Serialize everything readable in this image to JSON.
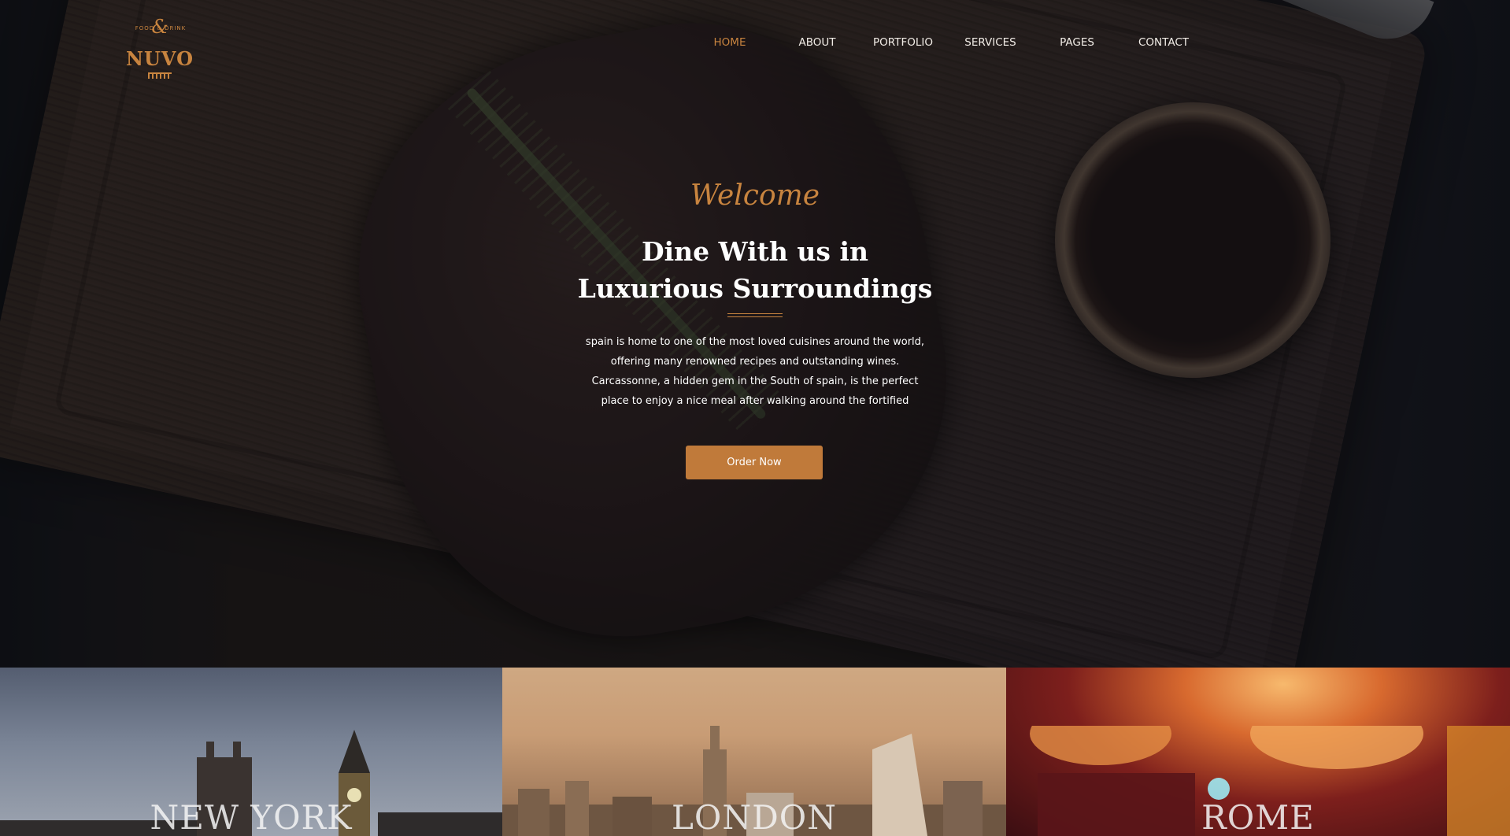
{
  "brand": {
    "logo_top": "FOOD & DRINK",
    "logo_amp": "&",
    "logo_name": "NUVO",
    "accent_color": "#c8843f"
  },
  "nav": {
    "items": [
      {
        "label": "HOME",
        "active": true
      },
      {
        "label": "ABOUT",
        "active": false
      },
      {
        "label": "PORTFOLIO",
        "active": false
      },
      {
        "label": "SERVICES",
        "active": false
      },
      {
        "label": "PAGES",
        "active": false
      },
      {
        "label": "CONTACT",
        "active": false
      }
    ]
  },
  "hero": {
    "welcome": "Welcome",
    "headline_line1": "Dine With us in",
    "headline_line2": "Luxurious Surroundings",
    "intro_lines": [
      "spain is home to one of the most loved cuisines around the world,",
      "offering many renowned recipes and outstanding wines.",
      "Carcassonne, a hidden gem in the South of spain, is the perfect",
      "place to enjoy a nice meal after walking around the fortified"
    ],
    "cta_label": "Order Now"
  },
  "cities": [
    {
      "name": "NEW YORK"
    },
    {
      "name": "LONDON"
    },
    {
      "name": "ROME"
    }
  ]
}
